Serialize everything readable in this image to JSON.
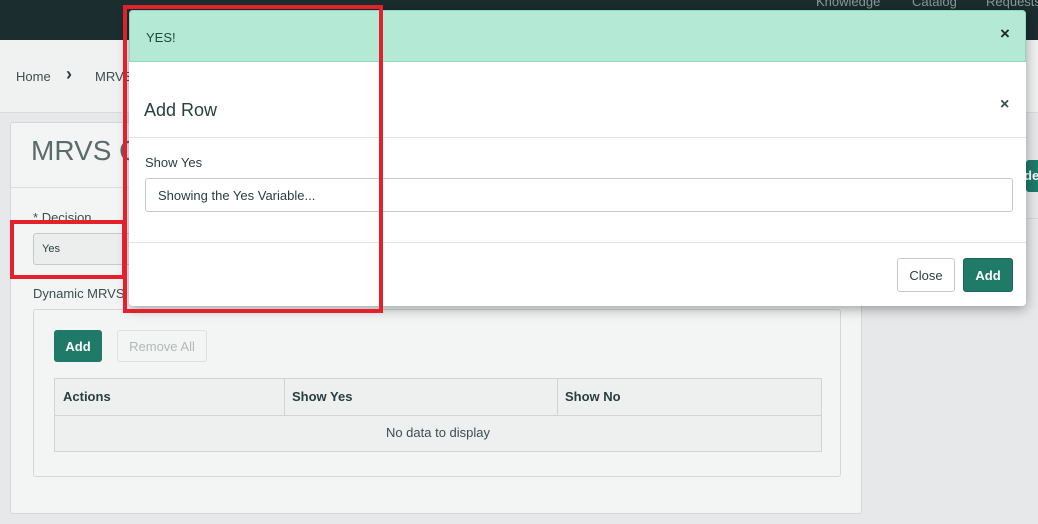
{
  "top_nav": [
    "Knowledge",
    "Catalog",
    "Requests"
  ],
  "breadcrumb": {
    "home": "Home",
    "current": "MRVS"
  },
  "page": {
    "title": "MRVS Q",
    "decision_required": "*",
    "decision_label": "Decision",
    "decision_value": "Yes",
    "dynamic_mrvs_label": "Dynamic MRVS",
    "add_label": "Add",
    "remove_all_label": "Remove All",
    "columns": [
      "Actions",
      "Show Yes",
      "Show No"
    ],
    "empty_text": "No data to display",
    "side_button_fragment": "de"
  },
  "modal": {
    "alert_text": "YES!",
    "alert_close": "×",
    "title": "Add Row",
    "close_x": "×",
    "field_label": "Show Yes",
    "field_value": "Showing the Yes Variable...",
    "close_label": "Close",
    "add_label": "Add"
  },
  "colors": {
    "accent": "#1f7a68",
    "alert_bg": "#b4ead5",
    "highlight": "#e3212d",
    "topbar": "#1b2d2f"
  }
}
